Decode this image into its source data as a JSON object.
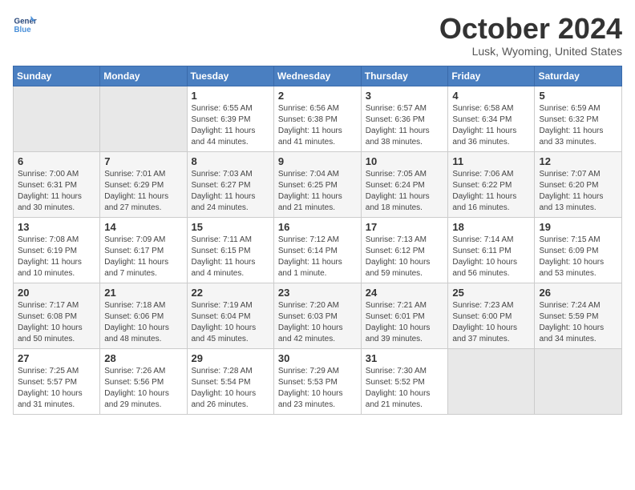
{
  "logo": {
    "line1": "General",
    "line2": "Blue"
  },
  "title": "October 2024",
  "location": "Lusk, Wyoming, United States",
  "weekdays": [
    "Sunday",
    "Monday",
    "Tuesday",
    "Wednesday",
    "Thursday",
    "Friday",
    "Saturday"
  ],
  "weeks": [
    [
      {
        "day": "",
        "info": ""
      },
      {
        "day": "",
        "info": ""
      },
      {
        "day": "1",
        "info": "Sunrise: 6:55 AM\nSunset: 6:39 PM\nDaylight: 11 hours and 44 minutes."
      },
      {
        "day": "2",
        "info": "Sunrise: 6:56 AM\nSunset: 6:38 PM\nDaylight: 11 hours and 41 minutes."
      },
      {
        "day": "3",
        "info": "Sunrise: 6:57 AM\nSunset: 6:36 PM\nDaylight: 11 hours and 38 minutes."
      },
      {
        "day": "4",
        "info": "Sunrise: 6:58 AM\nSunset: 6:34 PM\nDaylight: 11 hours and 36 minutes."
      },
      {
        "day": "5",
        "info": "Sunrise: 6:59 AM\nSunset: 6:32 PM\nDaylight: 11 hours and 33 minutes."
      }
    ],
    [
      {
        "day": "6",
        "info": "Sunrise: 7:00 AM\nSunset: 6:31 PM\nDaylight: 11 hours and 30 minutes."
      },
      {
        "day": "7",
        "info": "Sunrise: 7:01 AM\nSunset: 6:29 PM\nDaylight: 11 hours and 27 minutes."
      },
      {
        "day": "8",
        "info": "Sunrise: 7:03 AM\nSunset: 6:27 PM\nDaylight: 11 hours and 24 minutes."
      },
      {
        "day": "9",
        "info": "Sunrise: 7:04 AM\nSunset: 6:25 PM\nDaylight: 11 hours and 21 minutes."
      },
      {
        "day": "10",
        "info": "Sunrise: 7:05 AM\nSunset: 6:24 PM\nDaylight: 11 hours and 18 minutes."
      },
      {
        "day": "11",
        "info": "Sunrise: 7:06 AM\nSunset: 6:22 PM\nDaylight: 11 hours and 16 minutes."
      },
      {
        "day": "12",
        "info": "Sunrise: 7:07 AM\nSunset: 6:20 PM\nDaylight: 11 hours and 13 minutes."
      }
    ],
    [
      {
        "day": "13",
        "info": "Sunrise: 7:08 AM\nSunset: 6:19 PM\nDaylight: 11 hours and 10 minutes."
      },
      {
        "day": "14",
        "info": "Sunrise: 7:09 AM\nSunset: 6:17 PM\nDaylight: 11 hours and 7 minutes."
      },
      {
        "day": "15",
        "info": "Sunrise: 7:11 AM\nSunset: 6:15 PM\nDaylight: 11 hours and 4 minutes."
      },
      {
        "day": "16",
        "info": "Sunrise: 7:12 AM\nSunset: 6:14 PM\nDaylight: 11 hours and 1 minute."
      },
      {
        "day": "17",
        "info": "Sunrise: 7:13 AM\nSunset: 6:12 PM\nDaylight: 10 hours and 59 minutes."
      },
      {
        "day": "18",
        "info": "Sunrise: 7:14 AM\nSunset: 6:11 PM\nDaylight: 10 hours and 56 minutes."
      },
      {
        "day": "19",
        "info": "Sunrise: 7:15 AM\nSunset: 6:09 PM\nDaylight: 10 hours and 53 minutes."
      }
    ],
    [
      {
        "day": "20",
        "info": "Sunrise: 7:17 AM\nSunset: 6:08 PM\nDaylight: 10 hours and 50 minutes."
      },
      {
        "day": "21",
        "info": "Sunrise: 7:18 AM\nSunset: 6:06 PM\nDaylight: 10 hours and 48 minutes."
      },
      {
        "day": "22",
        "info": "Sunrise: 7:19 AM\nSunset: 6:04 PM\nDaylight: 10 hours and 45 minutes."
      },
      {
        "day": "23",
        "info": "Sunrise: 7:20 AM\nSunset: 6:03 PM\nDaylight: 10 hours and 42 minutes."
      },
      {
        "day": "24",
        "info": "Sunrise: 7:21 AM\nSunset: 6:01 PM\nDaylight: 10 hours and 39 minutes."
      },
      {
        "day": "25",
        "info": "Sunrise: 7:23 AM\nSunset: 6:00 PM\nDaylight: 10 hours and 37 minutes."
      },
      {
        "day": "26",
        "info": "Sunrise: 7:24 AM\nSunset: 5:59 PM\nDaylight: 10 hours and 34 minutes."
      }
    ],
    [
      {
        "day": "27",
        "info": "Sunrise: 7:25 AM\nSunset: 5:57 PM\nDaylight: 10 hours and 31 minutes."
      },
      {
        "day": "28",
        "info": "Sunrise: 7:26 AM\nSunset: 5:56 PM\nDaylight: 10 hours and 29 minutes."
      },
      {
        "day": "29",
        "info": "Sunrise: 7:28 AM\nSunset: 5:54 PM\nDaylight: 10 hours and 26 minutes."
      },
      {
        "day": "30",
        "info": "Sunrise: 7:29 AM\nSunset: 5:53 PM\nDaylight: 10 hours and 23 minutes."
      },
      {
        "day": "31",
        "info": "Sunrise: 7:30 AM\nSunset: 5:52 PM\nDaylight: 10 hours and 21 minutes."
      },
      {
        "day": "",
        "info": ""
      },
      {
        "day": "",
        "info": ""
      }
    ]
  ]
}
